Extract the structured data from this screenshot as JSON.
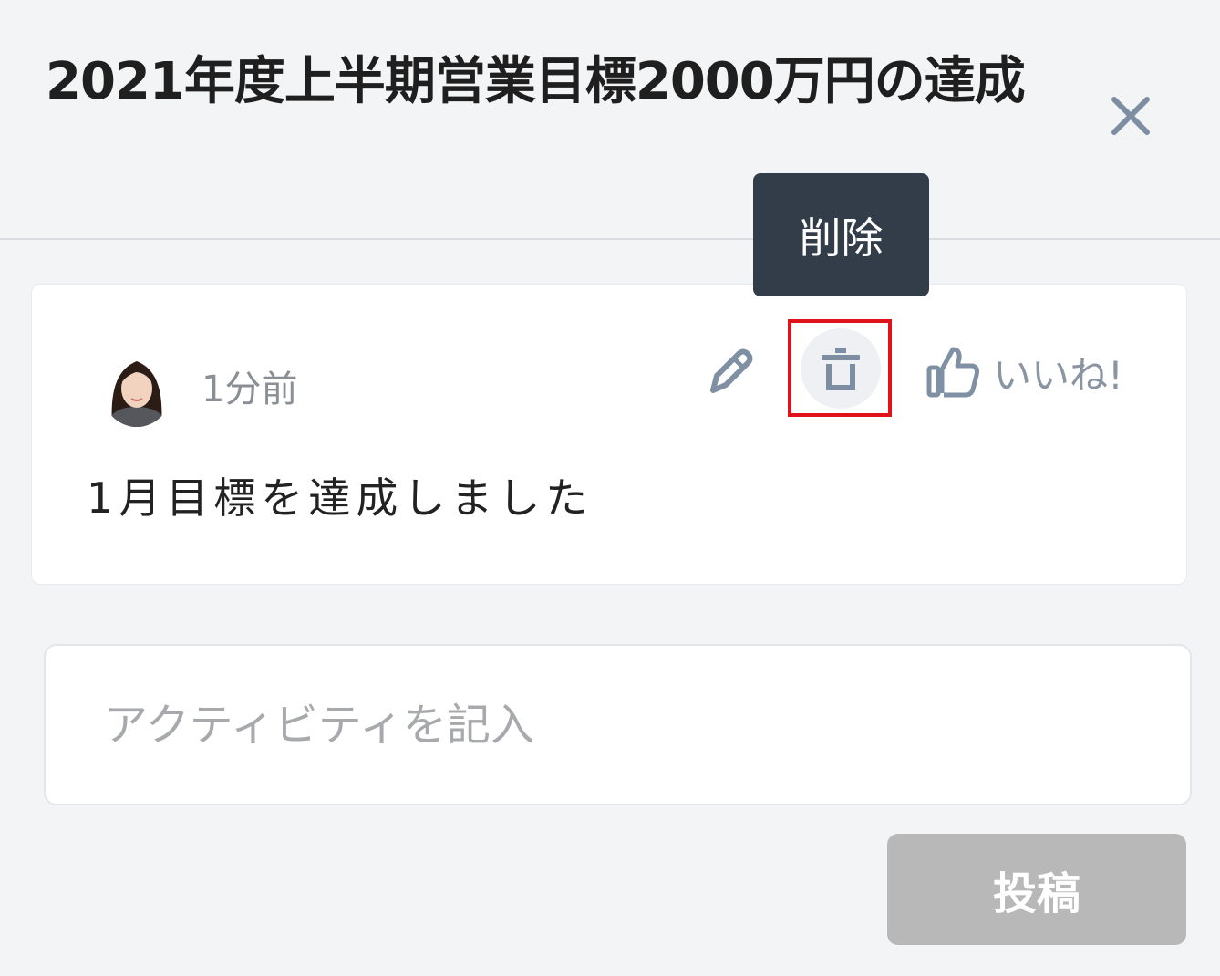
{
  "header": {
    "title": "2021年度上半期営業目標2000万円の達成",
    "close_icon": "close-icon"
  },
  "tooltip": {
    "text": "削除"
  },
  "activity": {
    "time": "1分前",
    "comment": "1月目標を達成しました",
    "like_label": "いいね!",
    "icons": [
      "pencil-icon",
      "trash-icon",
      "thumbs-up-icon"
    ]
  },
  "composer": {
    "placeholder": "アクティビティを記入",
    "value": "",
    "post_label": "投稿"
  },
  "colors": {
    "background": "#f3f4f6",
    "tooltip_bg": "#333d4a",
    "icon": "#8090a4",
    "highlight": "#e0131b",
    "post_button_disabled": "#b8b8b8"
  }
}
